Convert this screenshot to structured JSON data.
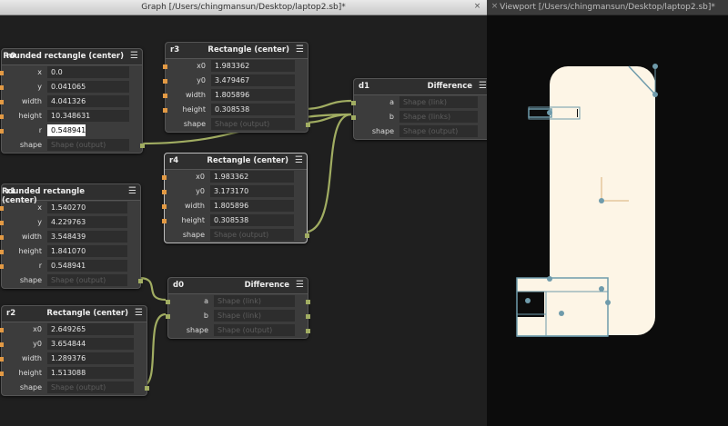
{
  "graph": {
    "title": "Graph [/Users/chingmansun/Desktop/laptop2.sb]*",
    "close_icon": "×"
  },
  "viewport": {
    "title": "Viewport [/Users/chingmansun/Desktop/laptop2.sb]*",
    "close_icon": "×"
  },
  "menu_icon": "☰",
  "nodes": {
    "r0": {
      "id": "r0",
      "type": "Rounded rectangle (center)",
      "rows": [
        {
          "label": "x",
          "value": "0.0"
        },
        {
          "label": "y",
          "value": "0.041065"
        },
        {
          "label": "width",
          "value": "4.041326"
        },
        {
          "label": "height",
          "value": "10.348631"
        },
        {
          "label": "r",
          "value": "0.548941"
        },
        {
          "label": "shape",
          "value": "Shape (output)"
        }
      ]
    },
    "r3": {
      "id": "r3",
      "type": "Rectangle (center)",
      "rows": [
        {
          "label": "x0",
          "value": "1.983362"
        },
        {
          "label": "y0",
          "value": "3.479467"
        },
        {
          "label": "width",
          "value": "1.805896"
        },
        {
          "label": "height",
          "value": "0.308538"
        },
        {
          "label": "shape",
          "value": "Shape (output)"
        }
      ]
    },
    "d1": {
      "id": "d1",
      "type": "Difference",
      "rows": [
        {
          "label": "a",
          "value": "Shape (link)"
        },
        {
          "label": "b",
          "value": "Shape (links)"
        },
        {
          "label": "shape",
          "value": "Shape (output)"
        }
      ]
    },
    "r4": {
      "id": "r4",
      "type": "Rectangle (center)",
      "rows": [
        {
          "label": "x0",
          "value": "1.983362"
        },
        {
          "label": "y0",
          "value": "3.173170"
        },
        {
          "label": "width",
          "value": "1.805896"
        },
        {
          "label": "height",
          "value": "0.308538"
        },
        {
          "label": "shape",
          "value": "Shape (output)"
        }
      ]
    },
    "r1": {
      "id": "r1",
      "type": "Rounded rectangle (center)",
      "rows": [
        {
          "label": "x",
          "value": "1.540270"
        },
        {
          "label": "y",
          "value": "4.229763"
        },
        {
          "label": "width",
          "value": "3.548439"
        },
        {
          "label": "height",
          "value": "1.841070"
        },
        {
          "label": "r",
          "value": "0.548941"
        },
        {
          "label": "shape",
          "value": "Shape (output)"
        }
      ]
    },
    "d0": {
      "id": "d0",
      "type": "Difference",
      "rows": [
        {
          "label": "a",
          "value": "Shape (link)"
        },
        {
          "label": "b",
          "value": "Shape (link)"
        },
        {
          "label": "shape",
          "value": "Shape (output)"
        }
      ]
    },
    "r2": {
      "id": "r2",
      "type": "Rectangle (center)",
      "rows": [
        {
          "label": "x0",
          "value": "2.649265"
        },
        {
          "label": "y0",
          "value": "3.654844"
        },
        {
          "label": "width",
          "value": "1.289376"
        },
        {
          "label": "height",
          "value": "1.513088"
        },
        {
          "label": "shape",
          "value": "Shape (output)"
        }
      ]
    }
  },
  "colors": {
    "wire": "#a1ad62",
    "port_input": "#e39a44",
    "shape_fill": "#fdf5e6",
    "handle": "#6f9bab"
  }
}
